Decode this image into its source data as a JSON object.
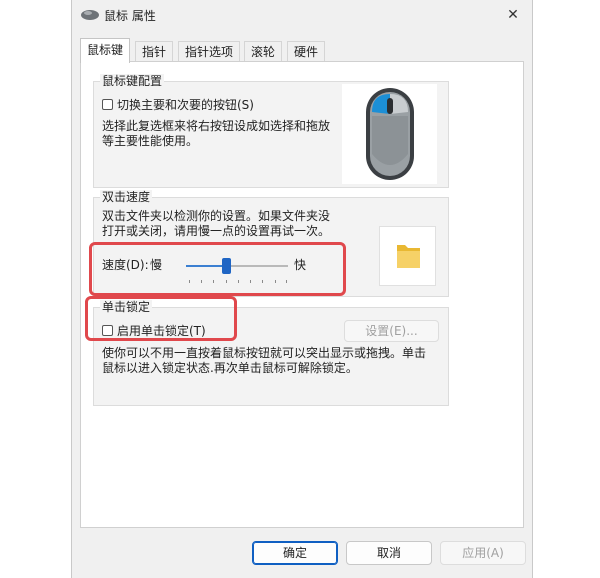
{
  "window": {
    "title": "鼠标 属性",
    "close_glyph": "✕"
  },
  "tabs": [
    {
      "label": "鼠标键",
      "active": true
    },
    {
      "label": "指针"
    },
    {
      "label": "指针选项"
    },
    {
      "label": "滚轮"
    },
    {
      "label": "硬件"
    }
  ],
  "button_config": {
    "title": "鼠标键配置",
    "swap_label": "切换主要和次要的按钮(S)",
    "swap_checked": false,
    "desc_line1": "选择此复选框来将右按钮设成如选择和拖放",
    "desc_line2": "等主要性能使用。"
  },
  "double_click": {
    "title": "双击速度",
    "desc_line1": "双击文件夹以检测你的设置。如果文件夹没",
    "desc_line2": "打开或关闭，请用慢一点的设置再试一次。",
    "speed_label": "速度(D):",
    "slow_label": "慢",
    "fast_label": "快",
    "slider_level": 0.4
  },
  "click_lock": {
    "title": "单击锁定",
    "enable_label": "启用单击锁定(T)",
    "enable_checked": false,
    "settings_label": "设置(E)...",
    "desc_line1": "使你可以不用一直按着鼠标按钮就可以突出显示或拖拽。单击",
    "desc_line2": "鼠标以进入锁定状态.再次单击鼠标可解除锁定。"
  },
  "footer": {
    "ok_label": "确定",
    "cancel_label": "取消",
    "apply_label": "应用(A)"
  },
  "colors": {
    "accent": "#1f65c4",
    "highlight": "#e0484c",
    "mouse_blue": "#1c8fd6"
  },
  "icons": [
    "mouse-app-icon",
    "close-icon",
    "mouse-illustration",
    "folder-icon"
  ]
}
